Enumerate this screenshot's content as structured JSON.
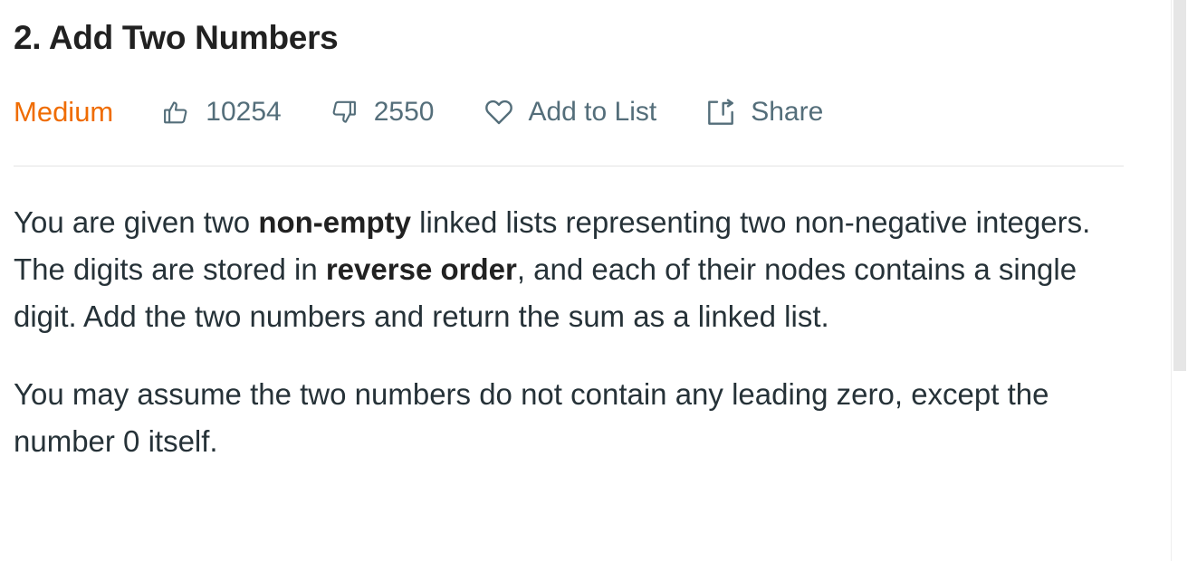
{
  "problem": {
    "title": "2. Add Two Numbers",
    "difficulty": "Medium",
    "likes": "10254",
    "dislikes": "2550",
    "add_to_list_label": "Add to List",
    "share_label": "Share"
  },
  "description": {
    "p1": {
      "t1": "You are given two ",
      "b1": "non-empty",
      "t2": " linked lists representing two non-negative integers. The digits are stored in ",
      "b2": "reverse order",
      "t3": ", and each of their nodes contains a single digit. Add the two numbers and return the sum as a linked list."
    },
    "p2": "You may assume the two numbers do not contain any leading zero, except the number 0 itself."
  },
  "icons": {
    "likes": "thumbs-up-icon",
    "dislikes": "thumbs-down-icon",
    "add_to_list": "heart-icon",
    "share": "share-icon"
  },
  "colors": {
    "difficulty_medium": "#ef6c00",
    "meta_text": "#546e7a",
    "body_text": "#263238"
  }
}
